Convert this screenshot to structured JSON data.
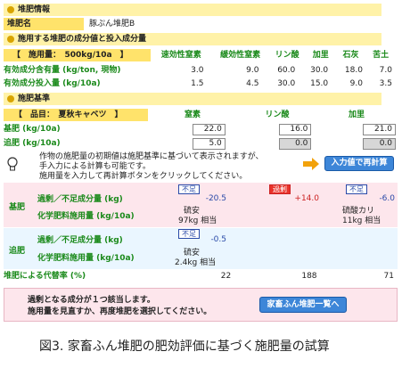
{
  "manure_info": {
    "section_title": "堆肥情報",
    "name_label": "堆肥名",
    "name_value": "豚ぷん堆肥B"
  },
  "components": {
    "section_title": "施用する堆肥の成分値と投入成分量",
    "app_rate_label": "【　施用量：　500kg/10a　】",
    "col_headers": [
      "速効性窒素",
      "緩効性窒素",
      "リン酸",
      "加里",
      "石灰",
      "苦土"
    ],
    "rows": [
      {
        "label": "有効成分含有量 (kg/ton, 現物)",
        "values": [
          "3.0",
          "9.0",
          "60.0",
          "30.0",
          "18.0",
          "7.0"
        ]
      },
      {
        "label": "有効成分投入量 (kg/10a)",
        "values": [
          "1.5",
          "4.5",
          "30.0",
          "15.0",
          "9.0",
          "3.5"
        ]
      }
    ]
  },
  "standard": {
    "section_title": "施肥基準",
    "crop_label": "【　品目：　夏秋キャベツ　】",
    "col_headers": [
      "窒素",
      "リン酸",
      "加里"
    ],
    "basal_label": "基肥 (kg/10a)",
    "basal_values": [
      "22.0",
      "16.0",
      "21.0"
    ],
    "top_label": "追肥 (kg/10a)",
    "top_values": [
      "5.0",
      "0.0",
      "0.0"
    ]
  },
  "notice": {
    "line1": "作物の施肥量の初期値は施肥基準に基づいて表示されますが、",
    "line2": "手入力による計算も可能です。",
    "line3": "施用量を入力して再計算ボタンをクリックしてください。",
    "recalc_button": "入力値で再計算"
  },
  "results": {
    "basal_group": "基肥",
    "top_group": "追肥",
    "excess_label": "過剰／不足成分量 (kg)",
    "chem_label": "化学肥料施用量 (kg/10a)",
    "basal_tags": [
      "不足",
      "過剰",
      "不足"
    ],
    "basal_excess": [
      "-20.5",
      "+14.0",
      "-6.0"
    ],
    "basal_chem_n": [
      "硫安",
      "97kg 相当"
    ],
    "basal_chem_k": [
      "硫酸カリ",
      "11kg 相当"
    ],
    "top_tag": "不足",
    "top_excess": "-0.5",
    "top_chem_n": [
      "硫安",
      "2.4kg 相当"
    ],
    "substitution_label": "堆肥による代替率 (%)",
    "substitution_values": [
      "22",
      "188",
      "71"
    ]
  },
  "footer": {
    "line1": "過剰となる成分が１つ該当します。",
    "line2": "施用量を見直すか、再度堆肥を選択してください。",
    "list_button": "家畜ふん堆肥一覧へ"
  },
  "caption": "図3. 家畜ふん堆肥の肥効評価に基づく施肥量の試算",
  "colors": {
    "section": "#fff2a8",
    "label": "#ffe36b",
    "accent_green": "#1b8a1b",
    "button_blue": "#3d86d8",
    "excess_red": "#e9332b",
    "panel_pink": "#fde6ec"
  }
}
